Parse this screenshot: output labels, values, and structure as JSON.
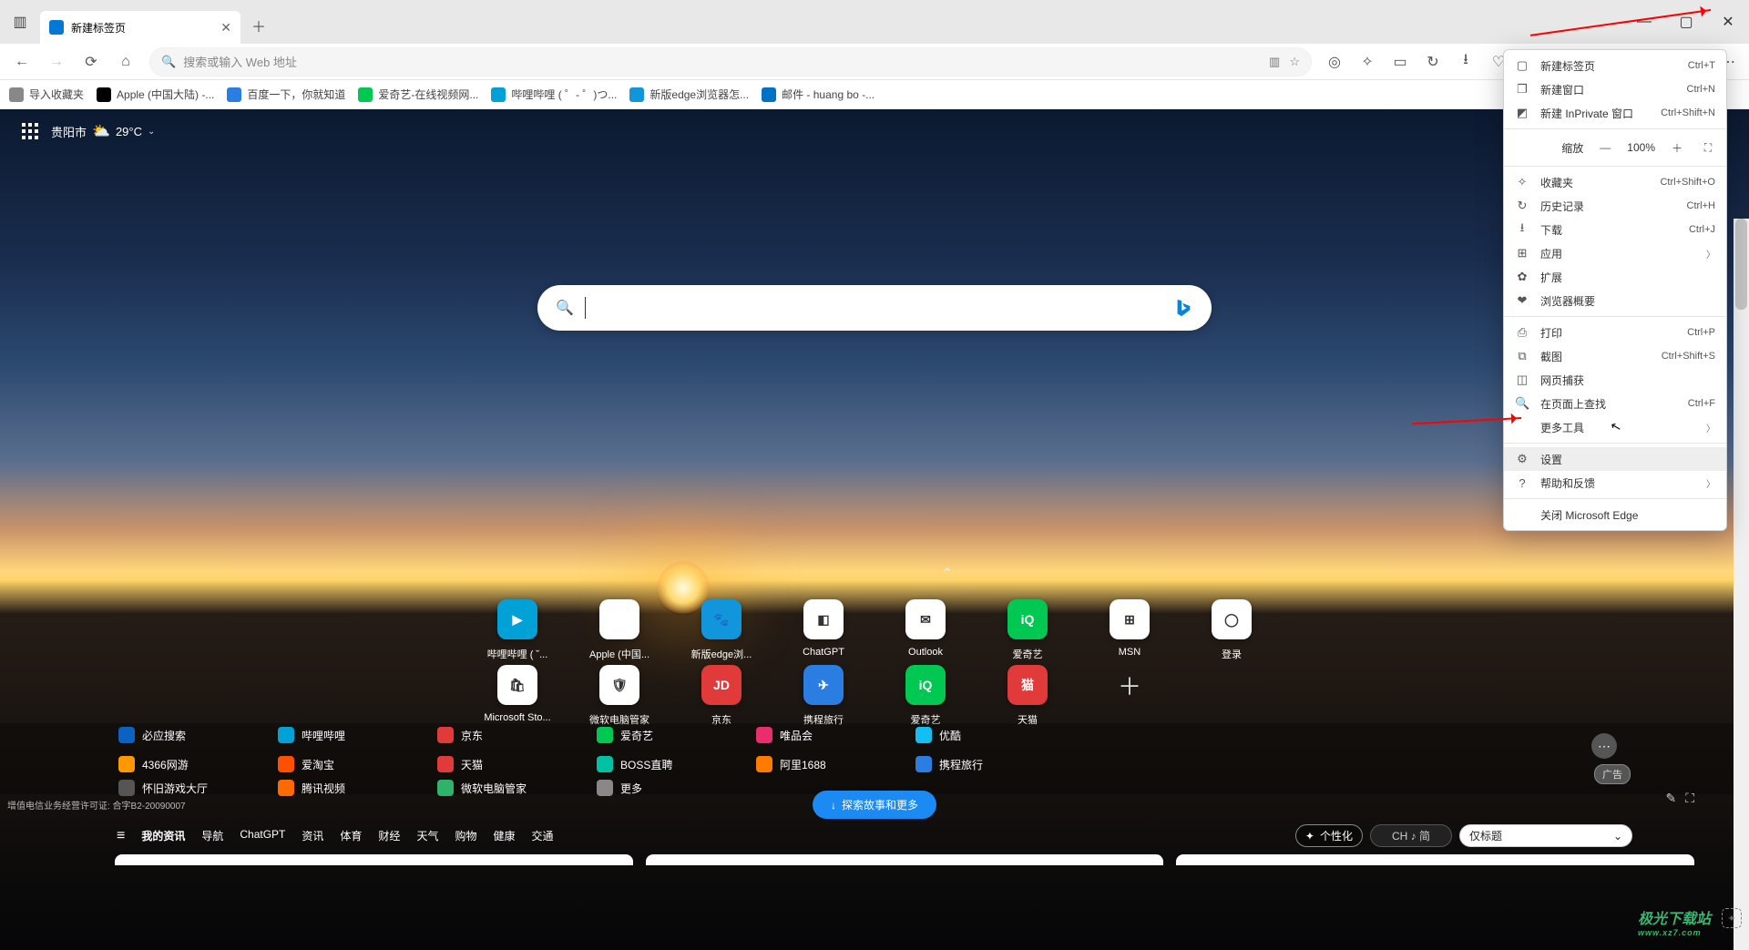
{
  "window": {
    "minimize": "—",
    "maximize": "▢",
    "close": "✕"
  },
  "tab": {
    "title": "新建标签页"
  },
  "toolbar": {
    "placeholder": "搜索或输入 Web 地址"
  },
  "bookmarks": [
    {
      "label": "导入收藏夹",
      "color": "#888"
    },
    {
      "label": "Apple (中国大陆) -...",
      "color": "#000"
    },
    {
      "label": "百度一下，你就知道",
      "color": "#2a7de1"
    },
    {
      "label": "爱奇艺-在线视频网...",
      "color": "#00c853"
    },
    {
      "label": "哔哩哔哩 ( ゜- ゜)つ...",
      "color": "#00a1d6"
    },
    {
      "label": "新版edge浏览器怎...",
      "color": "#1296db"
    },
    {
      "label": "邮件 - huang bo -...",
      "color": "#0072c6"
    }
  ],
  "ntp": {
    "city": "贵阳市",
    "temp": "29°C",
    "tiles_row1": [
      {
        "label": "哔哩哔哩 ( ˘...",
        "bg": "#00a1d6",
        "glyph": "▶"
      },
      {
        "label": "Apple (中国...",
        "bg": "#fff",
        "glyph": ""
      },
      {
        "label": "新版edge浏...",
        "bg": "#1296db",
        "glyph": "🐾"
      },
      {
        "label": "ChatGPT",
        "bg": "#fff",
        "glyph": "◧"
      },
      {
        "label": "Outlook",
        "bg": "#fff",
        "glyph": "✉"
      },
      {
        "label": "爱奇艺",
        "bg": "#00c853",
        "glyph": "iQ"
      },
      {
        "label": "MSN",
        "bg": "#fff",
        "glyph": "⊞"
      },
      {
        "label": "登录",
        "bg": "#fff",
        "glyph": "◯"
      }
    ],
    "tiles_row2": [
      {
        "label": "Microsoft Sto...",
        "bg": "#fff",
        "glyph": "🛍"
      },
      {
        "label": "微软电脑管家",
        "bg": "#fff",
        "glyph": "🛡"
      },
      {
        "label": "京东",
        "bg": "#e03a3a",
        "glyph": "JD"
      },
      {
        "label": "携程旅行",
        "bg": "#2a7de1",
        "glyph": "✈"
      },
      {
        "label": "爱奇艺",
        "bg": "#00c853",
        "glyph": "iQ"
      },
      {
        "label": "天猫",
        "bg": "#e03a3a",
        "glyph": "猫"
      }
    ],
    "quicklinks": [
      {
        "label": "必应搜索",
        "bg": "#0b62c3"
      },
      {
        "label": "哔哩哔哩",
        "bg": "#00a1d6"
      },
      {
        "label": "京东",
        "bg": "#e03a3a"
      },
      {
        "label": "爱奇艺",
        "bg": "#00c853"
      },
      {
        "label": "唯品会",
        "bg": "#ea2d6c"
      },
      {
        "label": "优酷",
        "bg": "#13bff2"
      },
      {
        "label": "4366网游",
        "bg": "#ff9800"
      },
      {
        "label": "爱淘宝",
        "bg": "#ff5000"
      },
      {
        "label": "天猫",
        "bg": "#e03a3a"
      },
      {
        "label": "BOSS直聘",
        "bg": "#00c1a4"
      },
      {
        "label": "阿里1688",
        "bg": "#ff7b00"
      },
      {
        "label": "携程旅行",
        "bg": "#2a7de1"
      },
      {
        "label": "怀旧游戏大厅",
        "bg": "#555"
      },
      {
        "label": "腾讯视频",
        "bg": "#ff6a00"
      },
      {
        "label": "微软电脑管家",
        "bg": "#2fb36a"
      },
      {
        "label": "更多",
        "bg": "#888"
      }
    ],
    "ad_label": "广告",
    "license": "增值电信业务经营许可证: 合字B2-20090007",
    "explore": "探索故事和更多",
    "nav": [
      "我的资讯",
      "导航",
      "ChatGPT",
      "资讯",
      "体育",
      "财经",
      "天气",
      "购物",
      "健康",
      "交通"
    ],
    "personalize": "个性化",
    "ch_label": "CH ♪ 简",
    "select_label": "仅标题"
  },
  "menu": {
    "new_tab": {
      "label": "新建标签页",
      "short": "Ctrl+T"
    },
    "new_window": {
      "label": "新建窗口",
      "short": "Ctrl+N"
    },
    "new_inprivate": {
      "label": "新建 InPrivate 窗口",
      "short": "Ctrl+Shift+N"
    },
    "zoom": {
      "label": "缩放",
      "level": "100%"
    },
    "favorites": {
      "label": "收藏夹",
      "short": "Ctrl+Shift+O"
    },
    "history": {
      "label": "历史记录",
      "short": "Ctrl+H"
    },
    "downloads": {
      "label": "下载",
      "short": "Ctrl+J"
    },
    "apps": {
      "label": "应用"
    },
    "extensions": {
      "label": "扩展"
    },
    "essentials": {
      "label": "浏览器概要"
    },
    "print": {
      "label": "打印",
      "short": "Ctrl+P"
    },
    "screenshot": {
      "label": "截图",
      "short": "Ctrl+Shift+S"
    },
    "webcapture": {
      "label": "网页捕获"
    },
    "find": {
      "label": "在页面上查找",
      "short": "Ctrl+F"
    },
    "more_tools": {
      "label": "更多工具"
    },
    "settings": {
      "label": "设置"
    },
    "help": {
      "label": "帮助和反馈"
    },
    "close_edge": {
      "label": "关闭 Microsoft Edge"
    }
  },
  "watermark": {
    "brand": "极光下载站",
    "url": "www.xz7.com"
  }
}
